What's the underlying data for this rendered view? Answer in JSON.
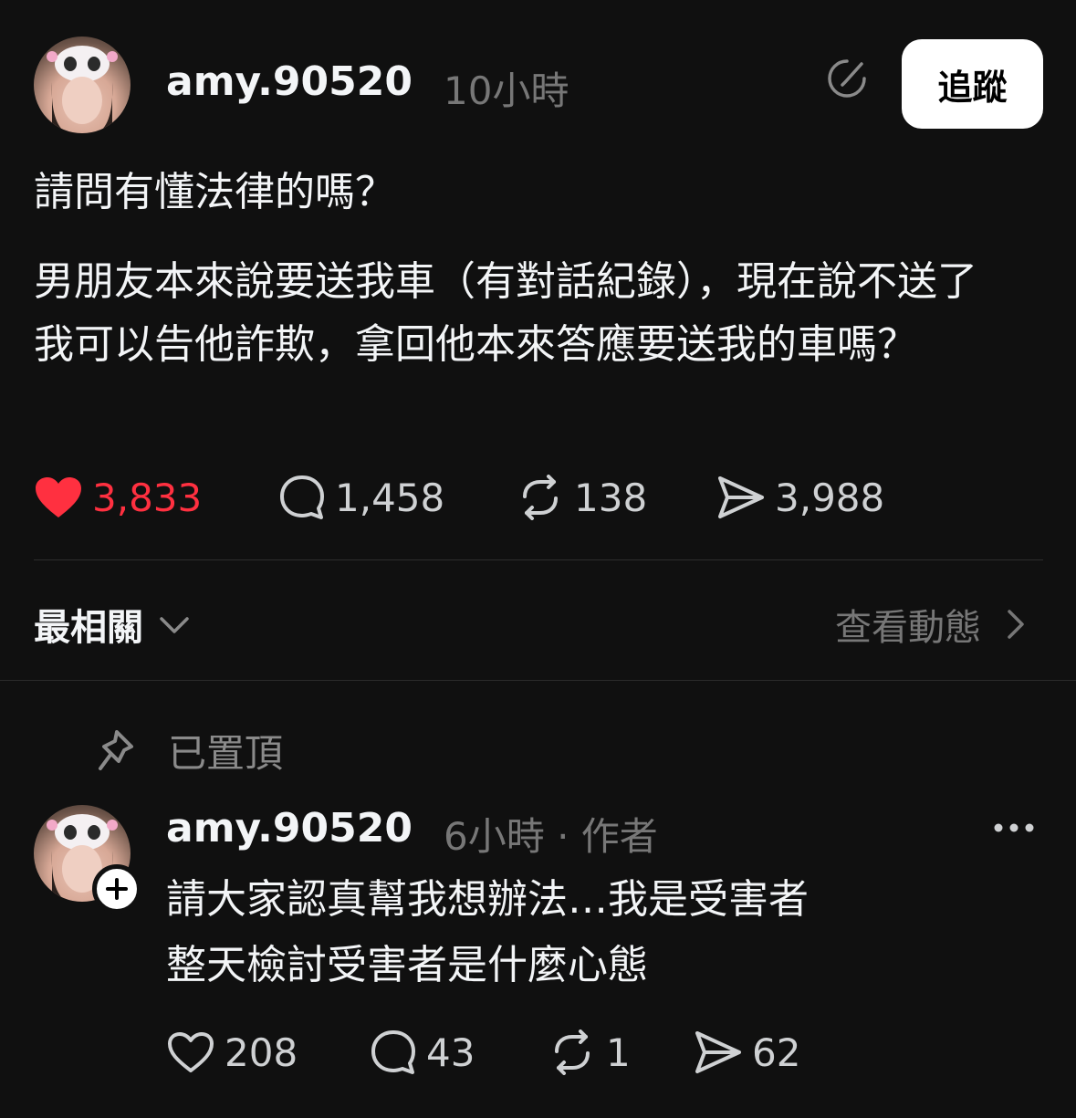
{
  "post": {
    "username": "amy.90520",
    "time": "10小時",
    "follow_label": "追蹤",
    "question": "請問有懂法律的嗎？",
    "lines": [
      "男朋友本來說要送我車（有對話紀錄），現在說不送了",
      "我可以告他詐欺，拿回他本來答應要送我的車嗎？"
    ],
    "stats": {
      "likes": "3,833",
      "comments": "1,458",
      "reposts": "138",
      "shares": "3,988"
    },
    "liked": true
  },
  "filter": {
    "sort_label": "最相關",
    "activity_label": "查看動態"
  },
  "reply": {
    "pinned_label": "已置頂",
    "username": "amy.90520",
    "time": "6小時 · 作者",
    "lines": [
      "請大家認真幫我想辦法…我是受害者",
      "整天檢討受害者是什麼心態"
    ],
    "stats": {
      "likes": "208",
      "comments": "43",
      "reposts": "1",
      "shares": "62"
    }
  },
  "colors": {
    "background": "#101010",
    "like_red": "#ff3040",
    "muted": "#777777"
  },
  "icons": [
    "edit-icon",
    "heart-icon",
    "comment-icon",
    "repost-icon",
    "share-icon",
    "chevron-down-icon",
    "chevron-right-icon",
    "pin-icon",
    "plus-icon",
    "more-icon"
  ]
}
